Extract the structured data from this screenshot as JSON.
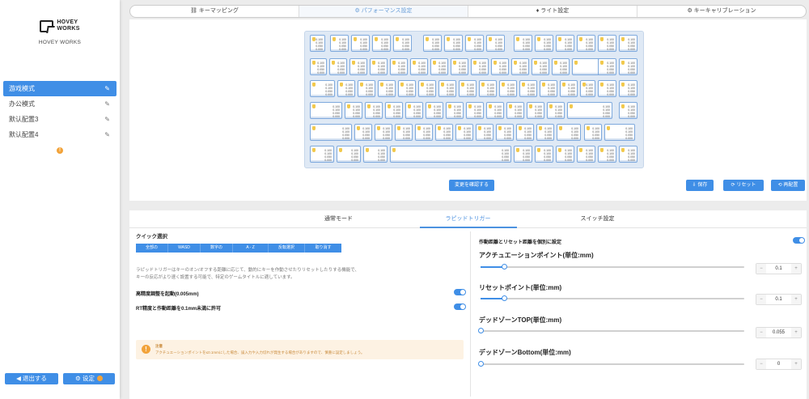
{
  "sidebar": {
    "brand_line1": "HOVEY",
    "brand_line2": "WORKS",
    "brand_sub": "HOVEY WORKS",
    "profiles": [
      {
        "label": "游戏模式"
      },
      {
        "label": "办公模式"
      },
      {
        "label": "默认配置3"
      },
      {
        "label": "默认配置4"
      }
    ],
    "warn_icon": "!",
    "exit_label": "◀ 退出する",
    "settings_label": "⚙ 设定"
  },
  "top_tabs": [
    {
      "label": "⛓ キーマッピング"
    },
    {
      "label": "⚙ パフォーマンス設定"
    },
    {
      "label": "♦ ライト設定"
    },
    {
      "label": "⚙ キーキャリブレーション"
    }
  ],
  "keyboard": {
    "key_value_top": "0.100",
    "key_value_mid": "0.100",
    "key_value_bottom": "0.050",
    "key_value_sub": "0.000",
    "confirm_label": "変更を確認する",
    "save_label": "⇩ 保存",
    "reset_label": "⟳ リセット",
    "relayout_label": "⟲ 再配置"
  },
  "mode_tabs": [
    {
      "label": "通常モード"
    },
    {
      "label": "ラピッドトリガー"
    },
    {
      "label": "スイッチ設定"
    }
  ],
  "quick_select": {
    "label": "クイック選択",
    "buttons": [
      "全部の",
      "WASD",
      "数字の",
      "A - Z",
      "反転選択",
      "取り消す"
    ]
  },
  "description_line1": "ラピッドトリガーはキーのオン/オフする距離に応じて、動的にキーを作動させたりリセットしたりする機能で、",
  "description_line2": "キーの反応がより速く設置する可能で、特定のゲームタイトルに適しています。",
  "options": [
    {
      "label": "高精度調整を起動(0.005mm)"
    },
    {
      "label": "RT精度と作動距離を0.1mm未満に許可"
    }
  ],
  "notice": {
    "title": "注意",
    "text": "アクチュエーションポイントを≤0.1mmにした場合、誤入力や入力切れが発生する場合がありますので、慎重に設定しましょう。"
  },
  "right_panel": {
    "title": "作動距離とリセット距離を個別に設定",
    "sliders": [
      {
        "label": "アクチュエーションポイント(単位:mm)",
        "value": "0.1",
        "fraction": 0.09
      },
      {
        "label": "リセットポイント(単位:mm)",
        "value": "0.1",
        "fraction": 0.09
      },
      {
        "label": "デッドゾーンTOP(単位:mm)",
        "value": "0.055",
        "fraction": 0.0
      },
      {
        "label": "デッドゾーンBottom(単位:mm)",
        "value": "0",
        "fraction": 0.0
      }
    ],
    "minus": "−",
    "plus": "+"
  },
  "colors": {
    "accent": "#3f8ee6",
    "warning": "#f2a33a"
  }
}
